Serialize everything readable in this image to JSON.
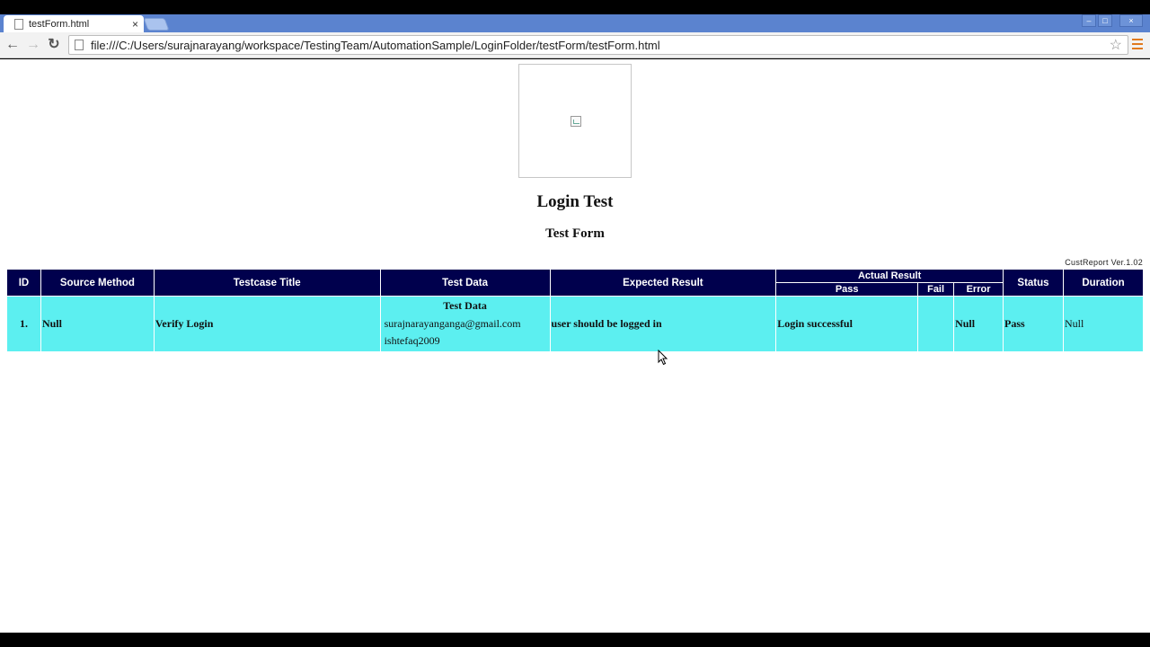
{
  "browser": {
    "tab_title": "testForm.html",
    "tab_close": "×",
    "url": "file:///C:/Users/surajnarayang/workspace/TestingTeam/AutomationSample/LoginFolder/testForm/testForm.html",
    "back_glyph": "←",
    "forward_glyph": "→",
    "reload_glyph": "↻",
    "star_glyph": "☆",
    "win_minimize": "–",
    "win_maximize": "□",
    "win_close": "×"
  },
  "page": {
    "title": "Login Test",
    "subtitle": "Test Form",
    "version": "CustReport Ver.1.02"
  },
  "table": {
    "headers": {
      "id": "ID",
      "source_method": "Source Method",
      "testcase_title": "Testcase Title",
      "test_data": "Test Data",
      "expected_result": "Expected Result",
      "actual_result": "Actual Result",
      "pass": "Pass",
      "fail": "Fail",
      "error": "Error",
      "status": "Status",
      "duration": "Duration"
    },
    "rows": [
      {
        "id": "1.",
        "source_method": "Null",
        "testcase_title": "Verify Login",
        "test_data_heading": "Test Data",
        "test_data_lines": [
          "surajnarayanganga@gmail.com",
          "ishtefaq2009"
        ],
        "expected_result": "user should be logged in",
        "pass": "Login successful",
        "fail": "",
        "error": "Null",
        "status": "Pass",
        "duration": "Null"
      }
    ]
  },
  "colors": {
    "header_bg": "#00004d",
    "row_bg": "#5ceff0",
    "tabstrip": "#5b83cf"
  }
}
